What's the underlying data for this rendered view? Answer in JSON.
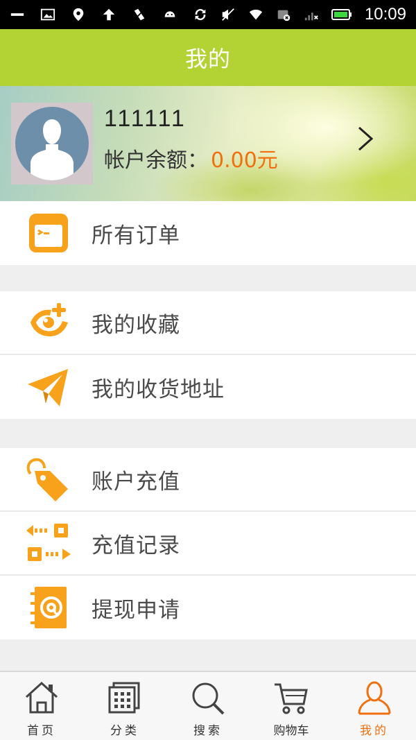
{
  "status_bar": {
    "time": "10:09",
    "icons": [
      "minus-icon",
      "image-icon",
      "location-pin-icon",
      "upload-arrow-icon",
      "no-tool-icon",
      "android-icon",
      "sync-icon",
      "mute-icon",
      "wifi-icon",
      "data-off-icon",
      "signal-icon",
      "battery-icon"
    ]
  },
  "header": {
    "title": "我的"
  },
  "profile": {
    "username": "111111",
    "balance_label": "帐户余额：",
    "balance_value": "0.00元"
  },
  "menu_groups": [
    {
      "items": [
        {
          "label": "所有订单",
          "icon": "orders-icon"
        }
      ]
    },
    {
      "items": [
        {
          "label": "我的收藏",
          "icon": "favorite-add-icon"
        },
        {
          "label": "我的收货地址",
          "icon": "paper-plane-icon"
        }
      ]
    },
    {
      "items": [
        {
          "label": "账户充值",
          "icon": "price-tag-icon"
        },
        {
          "label": "充值记录",
          "icon": "transfer-icon"
        },
        {
          "label": "提现申请",
          "icon": "address-book-icon"
        }
      ]
    }
  ],
  "tabbar": {
    "tabs": [
      {
        "label": "首页",
        "icon": "home-icon"
      },
      {
        "label": "分类",
        "icon": "grid-icon"
      },
      {
        "label": "搜索",
        "icon": "search-icon"
      },
      {
        "label": "购物车",
        "icon": "cart-icon"
      },
      {
        "label": "我的",
        "icon": "user-icon",
        "active": true
      }
    ]
  },
  "colors": {
    "header_bg": "#b3d334",
    "accent_orange": "#f7a21a",
    "balance_orange": "#f07010",
    "tab_active": "#f07010"
  }
}
